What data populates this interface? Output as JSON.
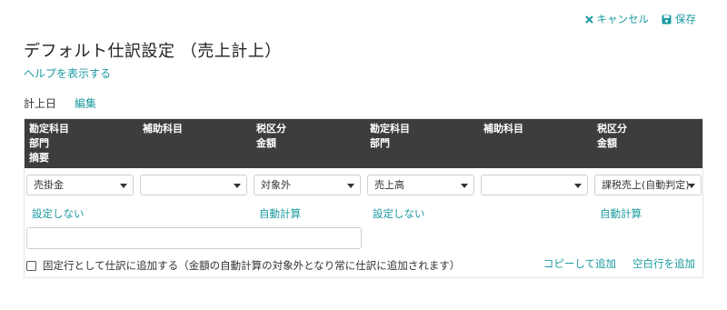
{
  "toolbar": {
    "cancel_label": "キャンセル",
    "save_label": "保存"
  },
  "page": {
    "title": "デフォルト仕訳設定 （売上計上）",
    "help_link": "ヘルプを表示する",
    "date_label": "計上日",
    "edit_label": "編集"
  },
  "table": {
    "headers": {
      "debit_account": "勘定科目",
      "debit_department": "部門",
      "description": "摘要",
      "debit_sub_account": "補助科目",
      "debit_tax": "税区分",
      "debit_amount": "金額",
      "credit_account": "勘定科目",
      "credit_department": "部門",
      "credit_sub_account": "補助科目",
      "credit_tax": "税区分",
      "credit_amount": "金額"
    },
    "row": {
      "debit_account": "売掛金",
      "debit_sub_account": "",
      "debit_tax": "対象外",
      "credit_account": "売上高",
      "credit_sub_account": "",
      "credit_tax": "課税売上(自動判定)",
      "debit_department_link": "設定しない",
      "debit_amount_link": "自動計算",
      "credit_department_link": "設定しない",
      "credit_amount_link": "自動計算",
      "memo_value": ""
    },
    "fixed_row_label": "固定行として仕訳に追加する（金額の自動計算の対象外となり常に仕訳に追加されます）",
    "fixed_row_checked": false,
    "copy_add_label": "コピーして追加",
    "blank_add_label": "空白行を追加"
  },
  "colors": {
    "accent": "#1a9aa0",
    "header_bg": "#3d3d3d"
  }
}
